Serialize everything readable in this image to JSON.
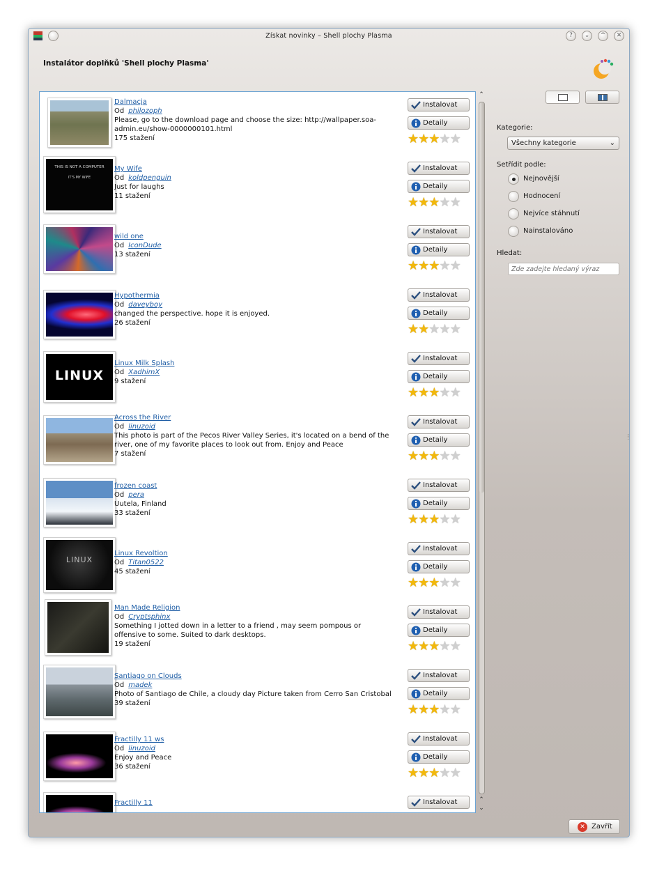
{
  "window": {
    "title": "Získat novinky – Shell plochy Plasma",
    "header_title": "Instalátor doplňků 'Shell plochy Plasma'",
    "buttons": [
      "?",
      "⌄",
      "^",
      "✕"
    ]
  },
  "list": {
    "items": [
      {
        "name": "Dalmacja",
        "by": "Od",
        "author": "philozoph",
        "desc": "Please, go to the download page and choose the size: http://wallpaper.soa-admin.eu/show-0000000101.html",
        "downloads": "175 stažení",
        "rating": 3
      },
      {
        "name": "My Wife",
        "by": "Od",
        "author": "koldpenguin",
        "desc": "Just for laughs",
        "downloads": "11 stažení",
        "rating": 3
      },
      {
        "name": "wild one",
        "by": "Od",
        "author": "IconDude",
        "desc": "",
        "downloads": "13 stažení",
        "rating": 3
      },
      {
        "name": "Hypothermia",
        "by": "Od",
        "author": "daveyboy",
        "desc": "changed the perspective. hope it is enjoyed.",
        "downloads": "26 stažení",
        "rating": 2
      },
      {
        "name": "Linux Milk Splash",
        "by": "Od",
        "author": "XadhimX",
        "desc": "",
        "downloads": "9 stažení",
        "rating": 3
      },
      {
        "name": "Across the River",
        "by": "Od",
        "author": "linuzoid",
        "desc": "This photo is part of the Pecos River Valley Series, it's located on a bend of the river, one of my favorite places to look out from. Enjoy and Peace",
        "downloads": "7 stažení",
        "rating": 3
      },
      {
        "name": "frozen coast",
        "by": "Od",
        "author": "pera",
        "desc": "Uutela, Finland",
        "downloads": "33 stažení",
        "rating": 3
      },
      {
        "name": "Linux Revoltion",
        "by": "Od",
        "author": "Titan0522",
        "desc": "",
        "downloads": "45 stažení",
        "rating": 3
      },
      {
        "name": "Man Made Religion",
        "by": "Od",
        "author": "Cryptsphinx",
        "desc": "Something I jotted down in a letter to a friend , may seem pompous or offensive to some. Suited to dark desktops.",
        "downloads": "19 stažení",
        "rating": 3
      },
      {
        "name": "Santiago on Clouds",
        "by": "Od",
        "author": "madek",
        "desc": "Photo of Santiago de Chile, a cloudy day Picture taken from Cerro San Cristobal",
        "downloads": "39 stažení",
        "rating": 3
      },
      {
        "name": "Fractilly 11 ws",
        "by": "Od",
        "author": "linuzoid",
        "desc": "Enjoy and Peace",
        "downloads": "36 stažení",
        "rating": 3
      },
      {
        "name": "Fractilly 11",
        "by": "",
        "author": "",
        "desc": "",
        "downloads": "",
        "rating": 0
      }
    ],
    "install_label": "Instalovat",
    "details_label": "Detaily",
    "thumb_my_wife_line1": "THIS IS NOT A COMPUTER",
    "thumb_my_wife_line2": "IT'S MY WIFE",
    "thumb_linux_splash": "LINUX",
    "thumb_linux_revolution": "LINUX"
  },
  "sidebar": {
    "category_label": "Kategorie:",
    "category_value": "Všechny kategorie",
    "sort_label": "Setřídit podle:",
    "sort_options": [
      {
        "label": "Nejnovější",
        "selected": true
      },
      {
        "label": "Hodnocení",
        "selected": false
      },
      {
        "label": "Nejvíce stáhnutí",
        "selected": false
      },
      {
        "label": "Nainstalováno",
        "selected": false
      }
    ],
    "search_label": "Hledat:",
    "search_placeholder": "Zde zadejte hledaný výraz"
  },
  "footer": {
    "close_label": "Zavřít"
  },
  "colors": {
    "link": "#1f5ea6",
    "star": "#f2b80c",
    "panel_border": "#6ba3d3"
  }
}
